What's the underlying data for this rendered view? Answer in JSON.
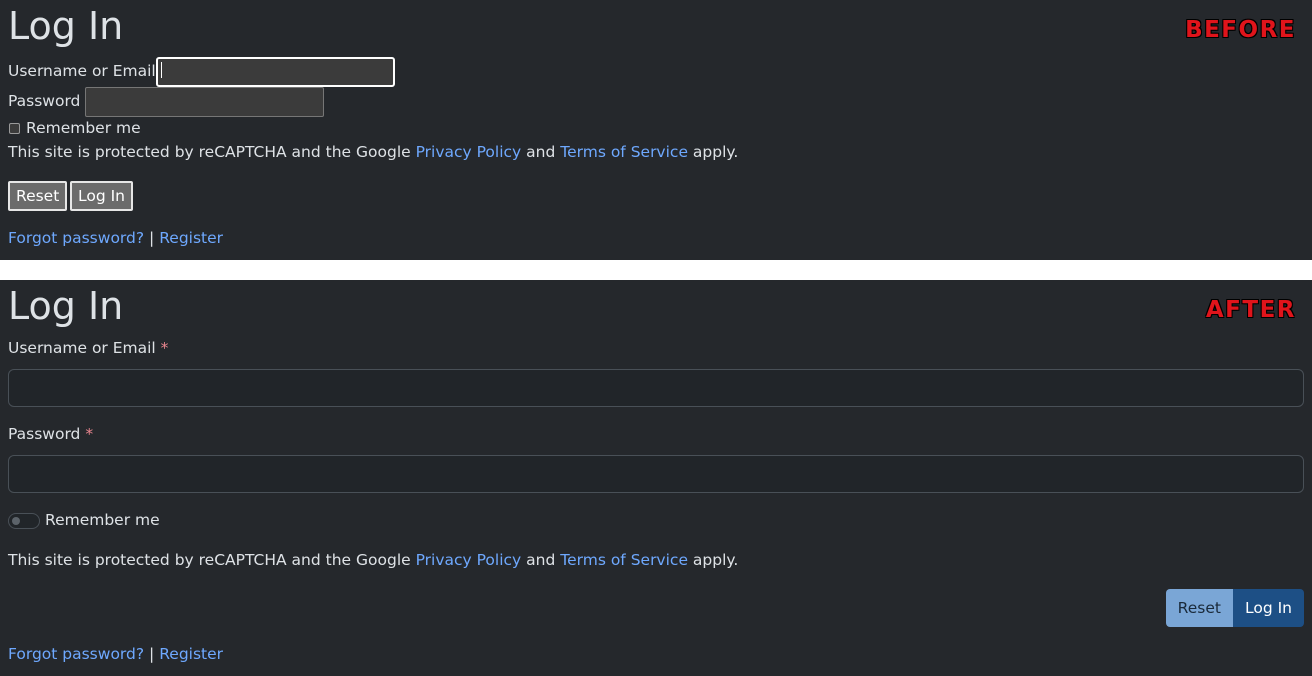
{
  "before": {
    "title": "Log In",
    "stamp": "BEFORE",
    "username_label": "Username or Email",
    "password_label": "Password",
    "remember_label": "Remember me",
    "recaptcha": {
      "prefix": "This site is protected by reCAPTCHA and the Google ",
      "privacy_link": "Privacy Policy",
      "and": " and ",
      "terms_link": "Terms of Service",
      "suffix": " apply."
    },
    "reset_button": "Reset",
    "login_button": "Log In",
    "forgot_link": "Forgot password?",
    "separator": "|",
    "register_link": "Register"
  },
  "after": {
    "title": "Log In",
    "stamp": "AFTER",
    "username_label": "Username or Email",
    "password_label": "Password",
    "required_marker": "*",
    "remember_label": "Remember me",
    "recaptcha": {
      "prefix": "This site is protected by reCAPTCHA and the Google ",
      "privacy_link": "Privacy Policy",
      "and": " and ",
      "terms_link": "Terms of Service",
      "suffix": " apply."
    },
    "reset_button": "Reset",
    "login_button": "Log In",
    "forgot_link": "Forgot password?",
    "separator": "|",
    "register_link": "Register"
  },
  "colors": {
    "panel_bg": "#25282c",
    "text": "#dee2e6",
    "link": "#6ea8fe",
    "required": "#ea868f",
    "stamp": "#e0141b",
    "reset_button": "#7aa6d6",
    "login_button": "#1d4f85"
  }
}
